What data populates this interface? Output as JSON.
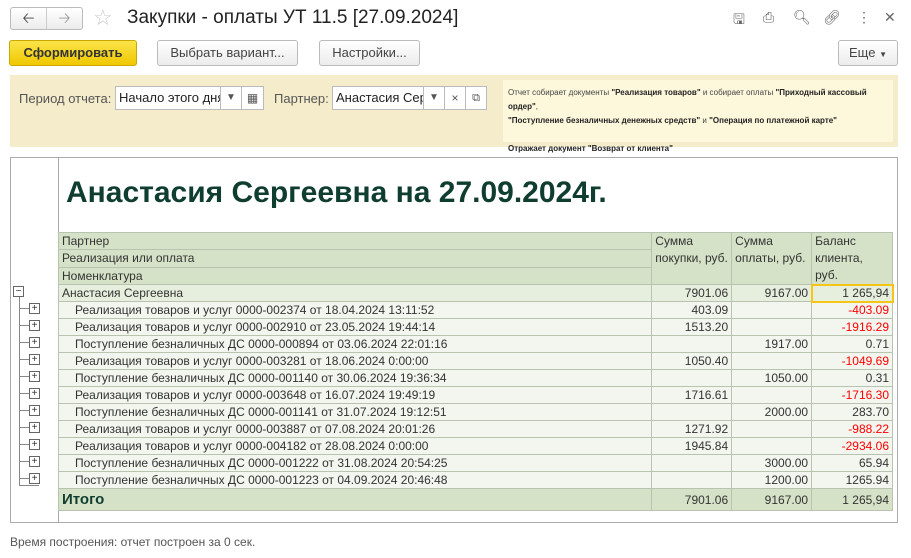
{
  "window": {
    "title": "Закупки - оплаты УТ 11.5 [27.09.2024]"
  },
  "toolbar": {
    "generate": "Сформировать",
    "variant": "Выбрать вариант...",
    "settings": "Настройки...",
    "more": "Еще"
  },
  "filters": {
    "period_label": "Период отчета:",
    "period_value": "Начало этого дня",
    "partner_label": "Партнер:",
    "partner_value": "Анастасия Сергеевна"
  },
  "note": {
    "p1a": "Отчет собирает документы ",
    "p1b": "\"Реализация товаров\"",
    "p1c": " и собирает оплаты ",
    "p1d": "\"Приходный кассовый ордер\"",
    "p1e": ", ",
    "p2a": "\"Поступление безналичных денежных средств\"",
    "p2b": " и ",
    "p2c": "\"Операция по платежной карте\"",
    "p3": "Отражает документ \"Возврат от клиента\""
  },
  "report": {
    "title": "Анастасия Сергеевна на 27.09.2024г.",
    "headers": {
      "h1": "Партнер",
      "h2": "Реализация или оплата",
      "h3": "Номенклатура",
      "purchase": "Сумма покупки, руб.",
      "payment": "Сумма оплаты, руб.",
      "balance": "Баланс клиента, руб."
    },
    "group": {
      "name": "Анастасия Сергеевна",
      "purchase": "7901.06",
      "payment": "9167.00",
      "balance": "1 265,94"
    },
    "rows": [
      {
        "name": "Реализация товаров и услуг 0000-002374 от 18.04.2024 13:11:52",
        "purchase": "403.09",
        "payment": "",
        "balance": "-403.09"
      },
      {
        "name": "Реализация товаров и услуг 0000-002910 от 23.05.2024 19:44:14",
        "purchase": "1513.20",
        "payment": "",
        "balance": "-1916.29"
      },
      {
        "name": "Поступление безналичных ДС 0000-000894 от 03.06.2024 22:01:16",
        "purchase": "",
        "payment": "1917.00",
        "balance": "0.71"
      },
      {
        "name": "Реализация товаров и услуг 0000-003281 от 18.06.2024 0:00:00",
        "purchase": "1050.40",
        "payment": "",
        "balance": "-1049.69"
      },
      {
        "name": "Поступление безналичных ДС 0000-001140 от 30.06.2024 19:36:34",
        "purchase": "",
        "payment": "1050.00",
        "balance": "0.31"
      },
      {
        "name": "Реализация товаров и услуг 0000-003648 от 16.07.2024 19:49:19",
        "purchase": "1716.61",
        "payment": "",
        "balance": "-1716.30"
      },
      {
        "name": "Поступление безналичных ДС 0000-001141 от 31.07.2024 19:12:51",
        "purchase": "",
        "payment": "2000.00",
        "balance": "283.70"
      },
      {
        "name": "Реализация товаров и услуг 0000-003887 от 07.08.2024 20:01:26",
        "purchase": "1271.92",
        "payment": "",
        "balance": "-988.22"
      },
      {
        "name": "Реализация товаров и услуг 0000-004182 от 28.08.2024 0:00:00",
        "purchase": "1945.84",
        "payment": "",
        "balance": "-2934.06"
      },
      {
        "name": "Поступление безналичных ДС 0000-001222 от 31.08.2024 20:54:25",
        "purchase": "",
        "payment": "3000.00",
        "balance": "65.94"
      },
      {
        "name": "Поступление безналичных ДС 0000-001223 от 04.09.2024 20:46:48",
        "purchase": "",
        "payment": "1200.00",
        "balance": "1265.94"
      }
    ],
    "total": {
      "label": "Итого",
      "purchase": "7901.06",
      "payment": "9167.00",
      "balance": "1 265,94"
    }
  },
  "footer": "Время построения: отчет построен за 0 сек."
}
